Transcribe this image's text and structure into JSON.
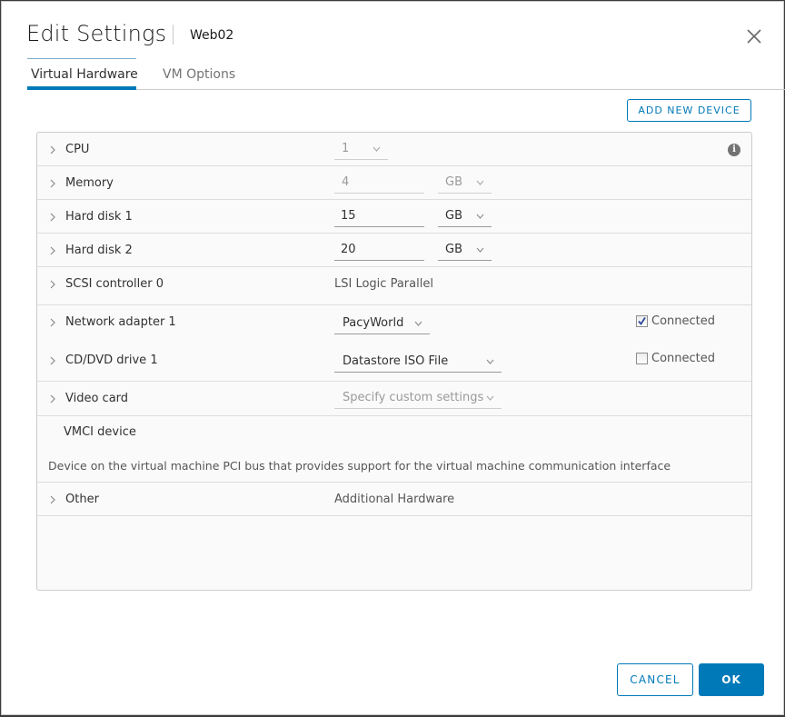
{
  "dialog": {
    "title": "Edit Settings",
    "subtitle": "Web02",
    "close_icon": "close-icon"
  },
  "tabs": [
    {
      "label": "Virtual Hardware",
      "active": true
    },
    {
      "label": "VM Options",
      "active": false
    }
  ],
  "toolbar": {
    "add_device_label": "ADD NEW DEVICE"
  },
  "hardware": {
    "cpu": {
      "label": "CPU",
      "value": "1",
      "disabled": true,
      "info_icon": "info-icon"
    },
    "memory": {
      "label": "Memory",
      "value": "4",
      "unit": "GB",
      "disabled": true
    },
    "hard_disk_1": {
      "label": "Hard disk 1",
      "value": "15",
      "unit": "GB"
    },
    "hard_disk_2": {
      "label": "Hard disk 2",
      "value": "20",
      "unit": "GB"
    },
    "scsi": {
      "label": "SCSI controller 0",
      "value": "LSI Logic Parallel"
    },
    "network": {
      "label": "Network adapter 1",
      "value": "PacyWorld",
      "connected_label": "Connected",
      "connected": true
    },
    "cdrom": {
      "label": "CD/DVD drive 1",
      "value": "Datastore ISO File",
      "connected_label": "Connected",
      "connected": false
    },
    "video": {
      "label": "Video card",
      "value": "Specify custom settings",
      "disabled": true
    },
    "vmci": {
      "label": "VMCI device",
      "description": "Device on the virtual machine PCI bus that provides support for the virtual machine communication interface"
    },
    "other": {
      "label": "Other",
      "value": "Additional Hardware"
    }
  },
  "footer": {
    "cancel_label": "CANCEL",
    "ok_label": "OK"
  },
  "colors": {
    "accent": "#0079b8",
    "panel_bg": "#fafafa",
    "border": "#cccccc"
  }
}
